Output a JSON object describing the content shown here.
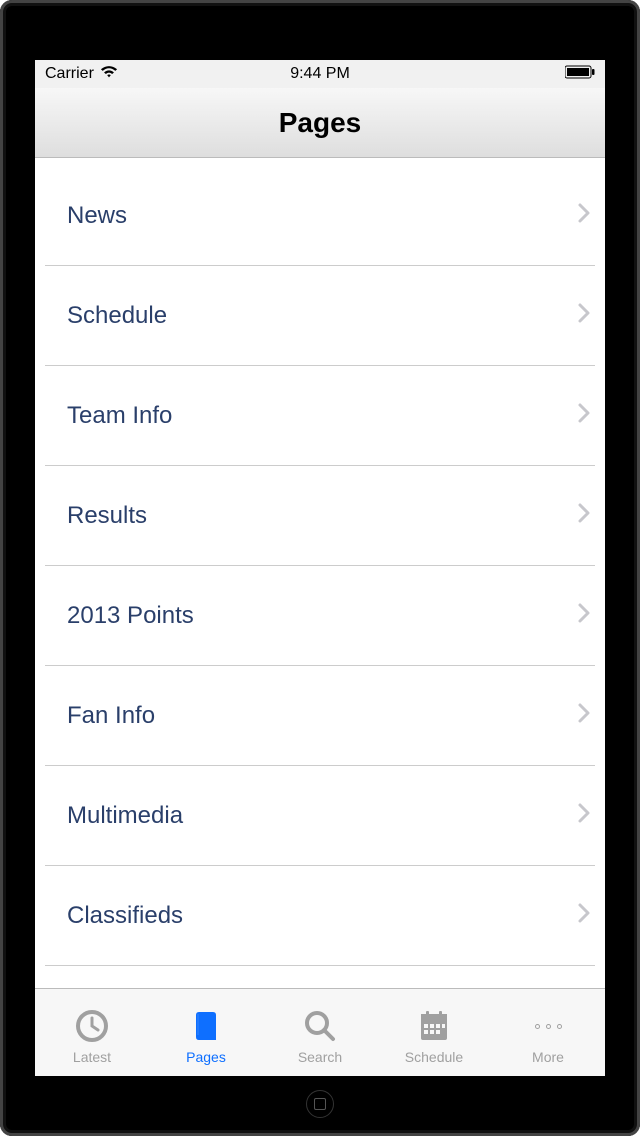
{
  "statusBar": {
    "carrier": "Carrier",
    "time": "9:44 PM"
  },
  "header": {
    "title": "Pages"
  },
  "pages": [
    {
      "label": "News"
    },
    {
      "label": "Schedule"
    },
    {
      "label": "Team Info"
    },
    {
      "label": "Results"
    },
    {
      "label": "2013 Points"
    },
    {
      "label": "Fan Info"
    },
    {
      "label": "Multimedia"
    },
    {
      "label": "Classifieds"
    }
  ],
  "tabs": [
    {
      "label": "Latest",
      "icon": "clock",
      "active": false
    },
    {
      "label": "Pages",
      "icon": "book",
      "active": true
    },
    {
      "label": "Search",
      "icon": "search",
      "active": false
    },
    {
      "label": "Schedule",
      "icon": "calendar",
      "active": false
    },
    {
      "label": "More",
      "icon": "more",
      "active": false
    }
  ]
}
